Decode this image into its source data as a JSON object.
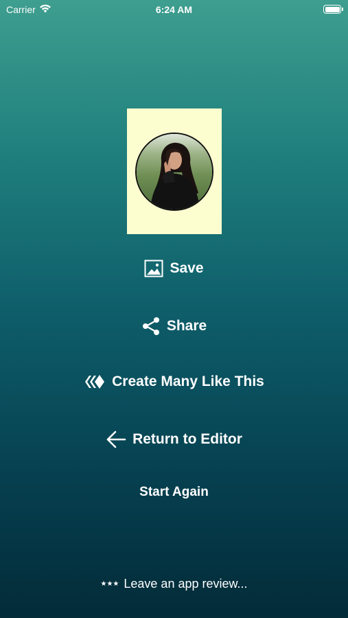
{
  "status_bar": {
    "carrier": "Carrier",
    "time": "6:24 AM",
    "icons": [
      "wifi-icon",
      "battery-icon"
    ]
  },
  "preview": {
    "background_color": "#fdfed0",
    "content": "circular portrait photo"
  },
  "actions": {
    "save_label": "Save",
    "share_label": "Share",
    "create_many_label": "Create Many Like This",
    "return_label": "Return to Editor",
    "start_again_label": "Start Again"
  },
  "review": {
    "stars": "★★★",
    "label": "Leave an app review..."
  },
  "colors": {
    "gradient_top": "#3e9e8f",
    "gradient_bottom": "#032b38",
    "text": "#ffffff"
  }
}
